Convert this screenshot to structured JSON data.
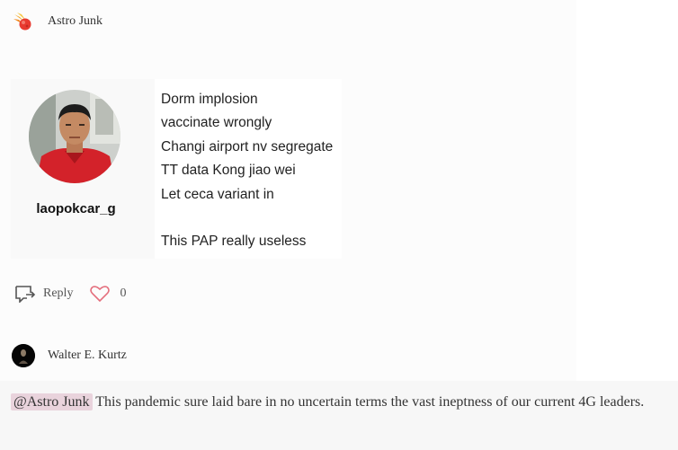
{
  "comment": {
    "author": "Astro Junk",
    "author_icon": "meteor-logo-icon",
    "embed": {
      "username": "laopokcar_g",
      "lines": [
        "Dorm implosion",
        "vaccinate wrongly",
        "Changi airport nv segregate",
        "TT data Kong jiao wei",
        "Let ceca variant in",
        "",
        "This PAP really useless"
      ]
    },
    "actions": {
      "reply_label": "Reply",
      "like_count": "0"
    }
  },
  "reply": {
    "author": "Walter E. Kurtz",
    "mention": "@Astro Junk",
    "text": " This pandemic sure laid bare in no uncertain terms the vast ineptness of our current 4G leaders."
  },
  "colors": {
    "heart": "#e46f7d",
    "mention_bg": "#e9d3dc",
    "page_bg": "#fcfcfc"
  }
}
